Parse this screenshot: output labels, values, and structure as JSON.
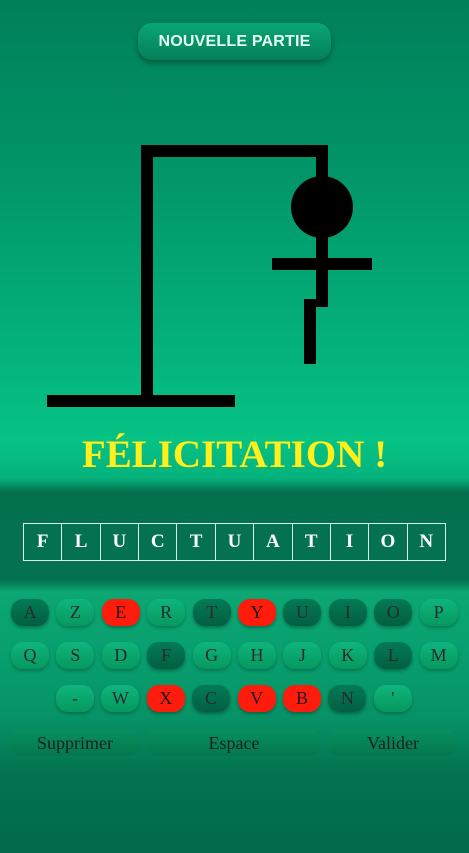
{
  "header": {
    "new_game_label": "NOUVELLE PARTIE"
  },
  "game": {
    "result_message": "FÉLICITATION !",
    "word_letters": [
      "F",
      "L",
      "U",
      "C",
      "T",
      "U",
      "A",
      "T",
      "I",
      "O",
      "N"
    ]
  },
  "keyboard": {
    "rows": [
      [
        {
          "label": "A",
          "state": "used"
        },
        {
          "label": "Z",
          "state": "normal"
        },
        {
          "label": "E",
          "state": "wrong"
        },
        {
          "label": "R",
          "state": "normal"
        },
        {
          "label": "T",
          "state": "used"
        },
        {
          "label": "Y",
          "state": "wrong"
        },
        {
          "label": "U",
          "state": "used"
        },
        {
          "label": "I",
          "state": "used"
        },
        {
          "label": "O",
          "state": "used"
        },
        {
          "label": "P",
          "state": "normal"
        }
      ],
      [
        {
          "label": "Q",
          "state": "normal"
        },
        {
          "label": "S",
          "state": "normal"
        },
        {
          "label": "D",
          "state": "normal"
        },
        {
          "label": "F",
          "state": "used"
        },
        {
          "label": "G",
          "state": "normal"
        },
        {
          "label": "H",
          "state": "normal"
        },
        {
          "label": "J",
          "state": "normal"
        },
        {
          "label": "K",
          "state": "normal"
        },
        {
          "label": "L",
          "state": "used"
        },
        {
          "label": "M",
          "state": "normal"
        }
      ],
      [
        {
          "label": "-",
          "state": "normal"
        },
        {
          "label": "W",
          "state": "normal"
        },
        {
          "label": "X",
          "state": "wrong"
        },
        {
          "label": "C",
          "state": "used"
        },
        {
          "label": "V",
          "state": "wrong"
        },
        {
          "label": "B",
          "state": "wrong"
        },
        {
          "label": "N",
          "state": "used"
        },
        {
          "label": "'",
          "state": "normal"
        }
      ]
    ],
    "actions": {
      "delete_label": "Supprimer",
      "space_label": "Espace",
      "submit_label": "Valider"
    }
  },
  "colors": {
    "banner": "#ffef1a",
    "wrong_key": "#ff1c0d",
    "figure": "#000000"
  }
}
